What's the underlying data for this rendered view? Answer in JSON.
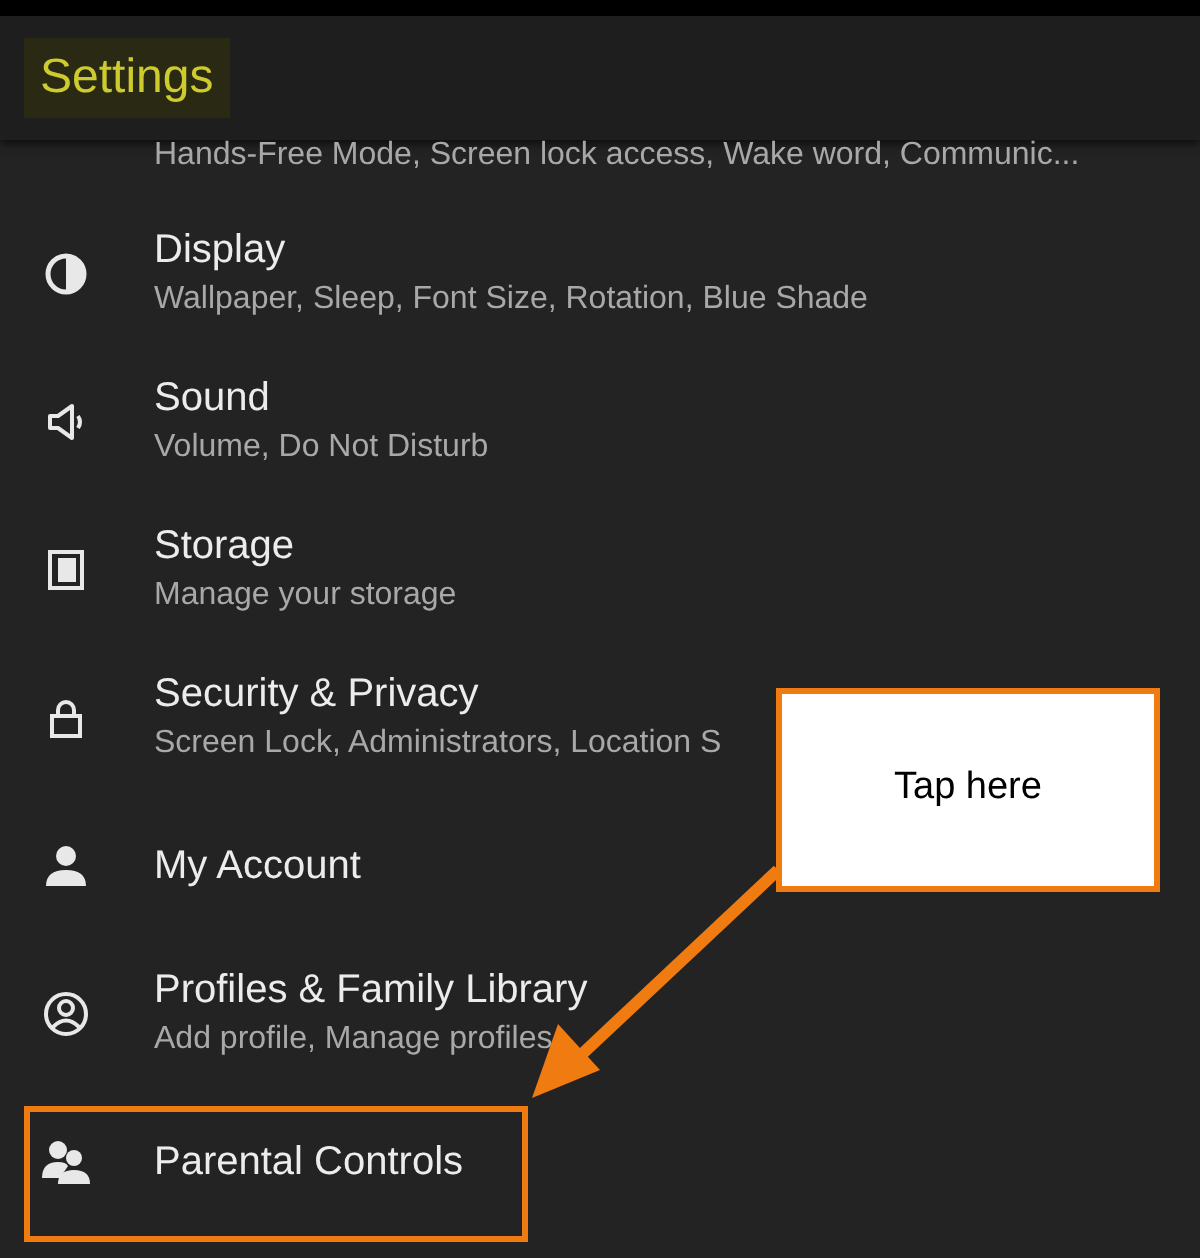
{
  "header": {
    "title": "Settings"
  },
  "items": [
    {
      "subtitle": "Hands-Free Mode, Screen lock access, Wake word, Communic..."
    },
    {
      "title": "Display",
      "subtitle": "Wallpaper, Sleep, Font Size, Rotation, Blue Shade"
    },
    {
      "title": "Sound",
      "subtitle": "Volume, Do Not Disturb"
    },
    {
      "title": "Storage",
      "subtitle": "Manage your storage"
    },
    {
      "title": "Security & Privacy",
      "subtitle": "Screen Lock, Administrators, Location S"
    },
    {
      "title": "My Account"
    },
    {
      "title": "Profiles & Family Library",
      "subtitle": "Add profile, Manage profiles"
    },
    {
      "title": "Parental Controls",
      "highlighted": true
    }
  ],
  "callout": {
    "text": "Tap here"
  }
}
